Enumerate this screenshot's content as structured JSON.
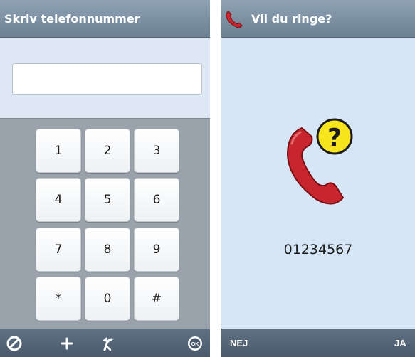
{
  "dial_screen": {
    "title": "Skriv telefonnummer",
    "input_value": "",
    "keypad": {
      "keys": [
        "1",
        "2",
        "3",
        "4",
        "5",
        "6",
        "7",
        "8",
        "9",
        "*",
        "0",
        "#"
      ]
    },
    "bottom_bar": {
      "icons": [
        "clear-icon",
        "plus-icon",
        "backspace-icon",
        "ok-icon"
      ],
      "plus_label": "+"
    }
  },
  "confirm_screen": {
    "title": "Vil du ringe?",
    "title_icon": "phone-icon",
    "question_mark": "?",
    "number": "01234567",
    "no_label": "NEJ",
    "yes_label": "JA"
  },
  "colors": {
    "titlebar": "#7d91a4",
    "keypad_bg": "#9aa2ac",
    "bottombar": "#55677a",
    "phone_red": "#c8262e",
    "question_yellow": "#f6e51c"
  }
}
